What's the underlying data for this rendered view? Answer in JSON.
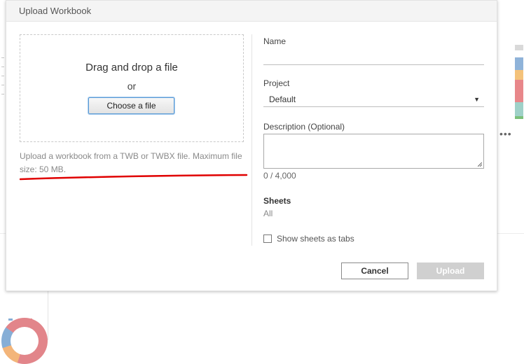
{
  "dialog": {
    "title": "Upload Workbook",
    "dropzone": {
      "title": "Drag and drop a file",
      "or": "or",
      "choose_label": "Choose a file"
    },
    "hint": "Upload a workbook from a TWB or TWBX file. Maximum file size: 50 MB.",
    "name": {
      "label": "Name",
      "value": ""
    },
    "project": {
      "label": "Project",
      "selected": "Default"
    },
    "description": {
      "label": "Description (Optional)",
      "value": "",
      "counter": "0 / 4,000"
    },
    "sheets": {
      "title": "Sheets",
      "value": "All"
    },
    "show_tabs": {
      "label": "Show sheets as tabs",
      "checked": false
    },
    "buttons": {
      "cancel": "Cancel",
      "upload": "Upload"
    }
  },
  "colors": {
    "annotation_red": "#e00000",
    "disabled_button": "#d0d0d0",
    "focus_blue": "#5b9bd5"
  }
}
